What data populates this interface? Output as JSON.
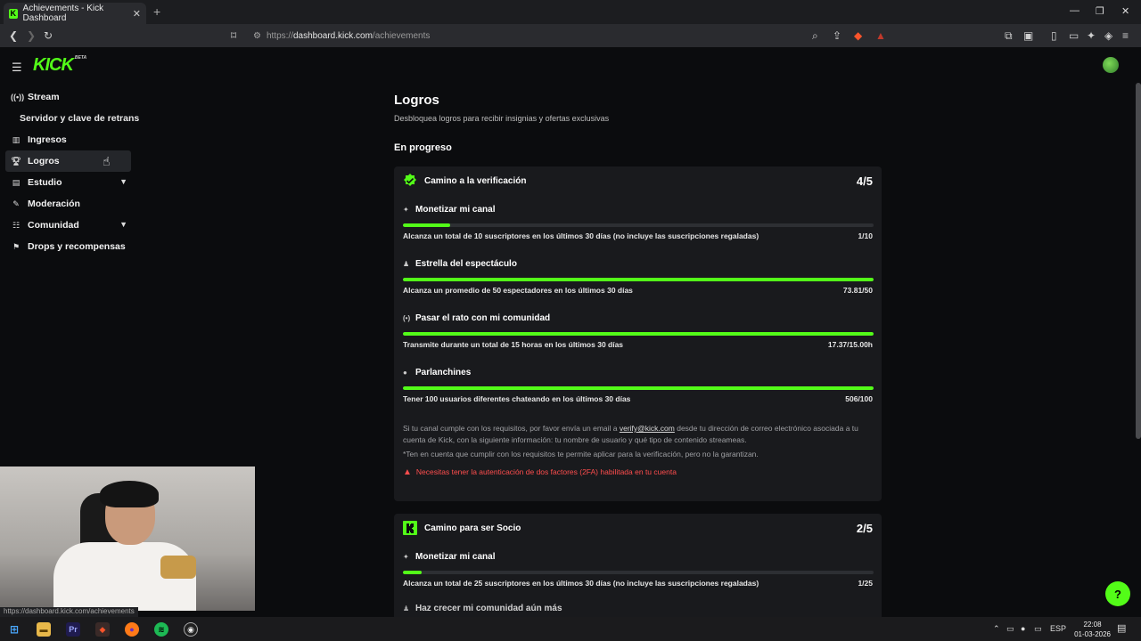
{
  "browser": {
    "tab_title": "Achievements - Kick Dashboard",
    "tab_icon": "kick-logo-icon",
    "url_prefix": "https://",
    "url_host": "dashboard.kick.com",
    "url_path": "/achievements",
    "status_url": "https://dashboard.kick.com/achievements"
  },
  "header": {
    "logo": "KICK",
    "logo_badge": "BETA"
  },
  "sidebar": {
    "items": [
      {
        "label": "Stream",
        "icon": "broadcast-icon"
      },
      {
        "label": "Servidor y clave de retransmisión",
        "icon": ""
      },
      {
        "label": "Ingresos",
        "icon": "chart-icon"
      },
      {
        "label": "Logros",
        "icon": "trophy-icon"
      },
      {
        "label": "Estudio",
        "icon": "studio-icon"
      },
      {
        "label": "Moderación",
        "icon": "wrench-icon"
      },
      {
        "label": "Comunidad",
        "icon": "people-icon"
      },
      {
        "label": "Drops y recompensas",
        "icon": "gift-icon"
      }
    ]
  },
  "main": {
    "title": "Logros",
    "subtitle": "Desbloquea logros para recibir insignias y ofertas exclusivas",
    "section": "En progreso",
    "cards": [
      {
        "title": "Camino a la verificación",
        "progress": "4/5",
        "tasks": [
          {
            "name": "Monetizar mi canal",
            "desc": "Alcanza un total de 10 suscriptores en los últimos 30 días (no incluye las suscripciones regaladas)",
            "value": "1/10",
            "fraction": 0.1
          },
          {
            "name": "Estrella del espectáculo",
            "desc": "Alcanza un promedio de 50 espectadores en los últimos 30 días",
            "value": "73.81/50",
            "fraction": 1.0
          },
          {
            "name": "Pasar el rato con mi comunidad",
            "desc": "Transmite durante un total de 15 horas en los últimos 30 días",
            "value": "17.37/15.00h",
            "fraction": 1.0
          },
          {
            "name": "Parlanchines",
            "desc": "Tener 100 usuarios diferentes chateando en los últimos 30 días",
            "value": "506/100",
            "fraction": 1.0
          }
        ],
        "note_1_before": "Si tu canal cumple con los requisitos, por favor envía un email a ",
        "note_email": "verify@kick.com",
        "note_1_after": " desde tu dirección de correo electrónico asociada a tu cuenta de Kick, con la siguiente información: tu nombre de usuario y qué tipo de contenido streameas.",
        "note_2": "*Ten en cuenta que cumplir con los requisitos te permite aplicar para la verificación, pero no la garantizan.",
        "warning": "Necesitas tener la autenticación de dos factores (2FA) habilitada en tu cuenta"
      },
      {
        "title": "Camino para ser Socio",
        "progress": "2/5",
        "tasks": [
          {
            "name": "Monetizar mi canal",
            "desc": "Alcanza un total de 25 suscriptores en los últimos 30 días (no incluye las suscripciones regaladas)",
            "value": "1/25",
            "fraction": 0.04
          },
          {
            "name": "Haz crecer mi comunidad aún más",
            "desc": "",
            "value": "",
            "fraction": 0
          }
        ]
      }
    ]
  },
  "taskbar": {
    "lang": "ESP",
    "time": "22:08",
    "date": "01-03-2026"
  },
  "colors": {
    "accent": "#53fc18",
    "warning": "#ff4d4d",
    "card_bg": "#191a1d"
  }
}
